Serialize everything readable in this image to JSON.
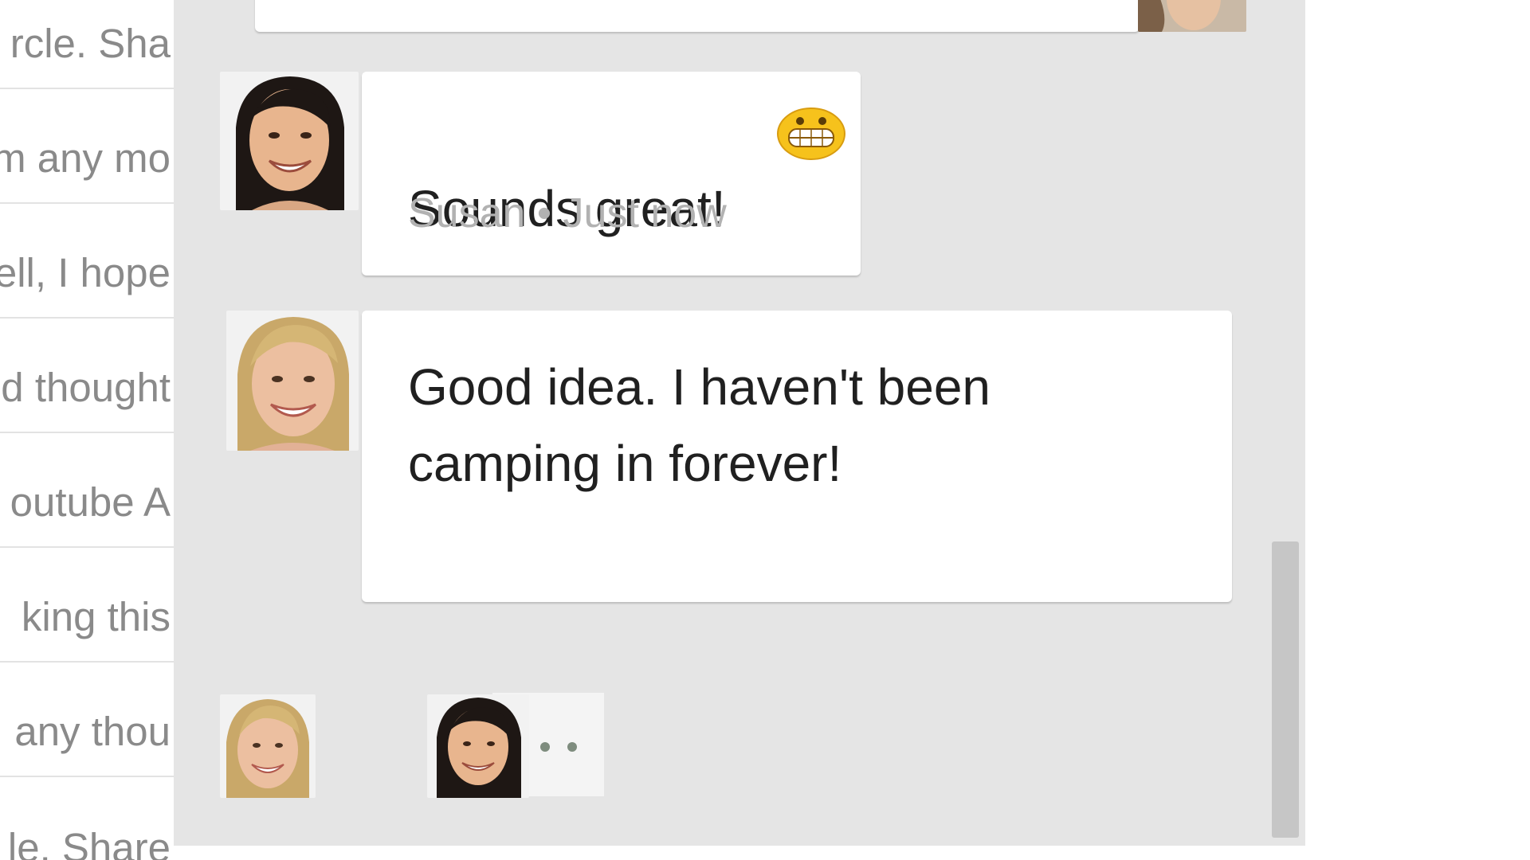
{
  "left_list": {
    "snippets": [
      "rcle. Sha",
      "m any mo",
      "ell, I hope",
      "d thought",
      "outube A",
      "king this",
      "any thou",
      "le. Share"
    ]
  },
  "chat": {
    "messages": [
      {
        "text": "Sounds great!",
        "emoji": "grinning-face-emoji",
        "sender": "Susan",
        "time": "Just now",
        "meta": "Susan • Just now"
      },
      {
        "lines": [
          "Good idea. I haven't been",
          "camping in forever!"
        ]
      }
    ],
    "typing_indicator": "• • •"
  },
  "colors": {
    "panel_bg": "#e5e5e5",
    "bubble_bg": "#ffffff",
    "meta_text": "#b2b2b2",
    "emoji_yellow": "#f6c21c"
  }
}
